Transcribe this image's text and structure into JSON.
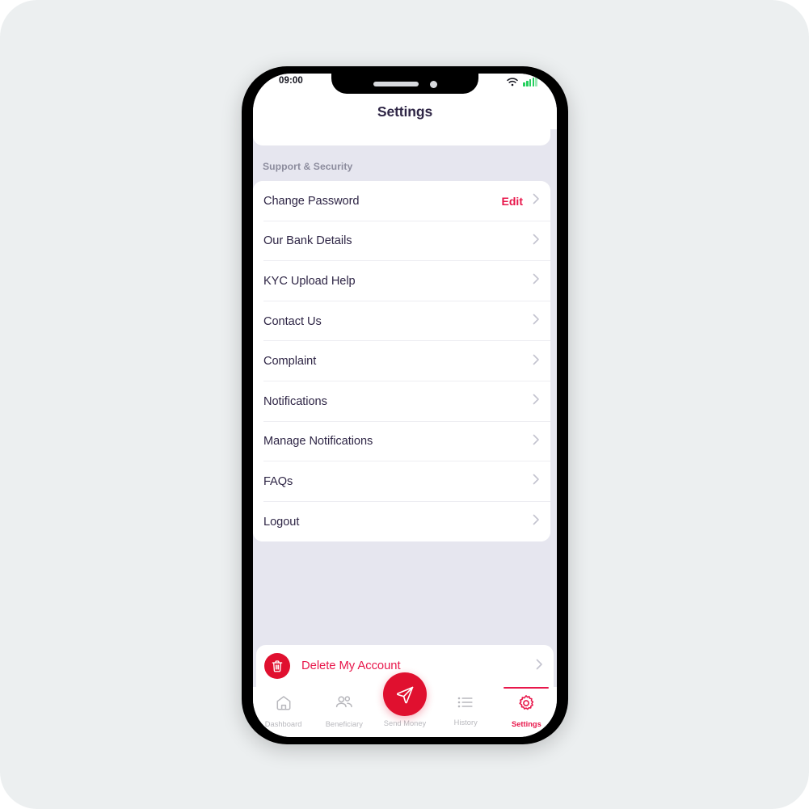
{
  "status_bar": {
    "time": "09:00",
    "wifi_icon": "wifi-icon",
    "battery_icon": "battery-icon",
    "battery_color": "#25cf5e"
  },
  "header": {
    "title": "Settings",
    "title_color": "#2e2545"
  },
  "theme": {
    "accent": "#e8174b",
    "fab_red": "#e0102f",
    "page_bg": "#e6e6ef",
    "card_bg": "#ffffff",
    "muted_text": "#8d8d9e",
    "chevron": "#c3c3cf"
  },
  "sections": [
    {
      "label": "Support & Security",
      "rows": [
        {
          "label": "Change Password",
          "action": "Edit",
          "chevron": true
        },
        {
          "label": "Our Bank Details",
          "action": "",
          "chevron": true
        },
        {
          "label": "KYC Upload Help",
          "action": "",
          "chevron": true
        },
        {
          "label": "Contact Us",
          "action": "",
          "chevron": true
        },
        {
          "label": "Complaint",
          "action": "",
          "chevron": true
        },
        {
          "label": "Notifications",
          "action": "",
          "chevron": true
        },
        {
          "label": "Manage Notifications",
          "action": "",
          "chevron": true
        },
        {
          "label": "FAQs",
          "action": "",
          "chevron": true
        },
        {
          "label": "Logout",
          "action": "",
          "chevron": true
        }
      ]
    }
  ],
  "delete_account": {
    "label": "Delete My Account",
    "icon": "trash-icon",
    "badge_color": "#e0102f",
    "text_color": "#e8174b"
  },
  "tabbar": {
    "items": [
      {
        "label": "Dashboard",
        "icon": "home-icon",
        "active": false
      },
      {
        "label": "Beneficiary",
        "icon": "people-icon",
        "active": false
      },
      {
        "label": "Send Money",
        "icon": "send-icon",
        "active": false
      },
      {
        "label": "History",
        "icon": "list-icon",
        "active": false
      },
      {
        "label": "Settings",
        "icon": "gear-icon",
        "active": true
      }
    ]
  }
}
